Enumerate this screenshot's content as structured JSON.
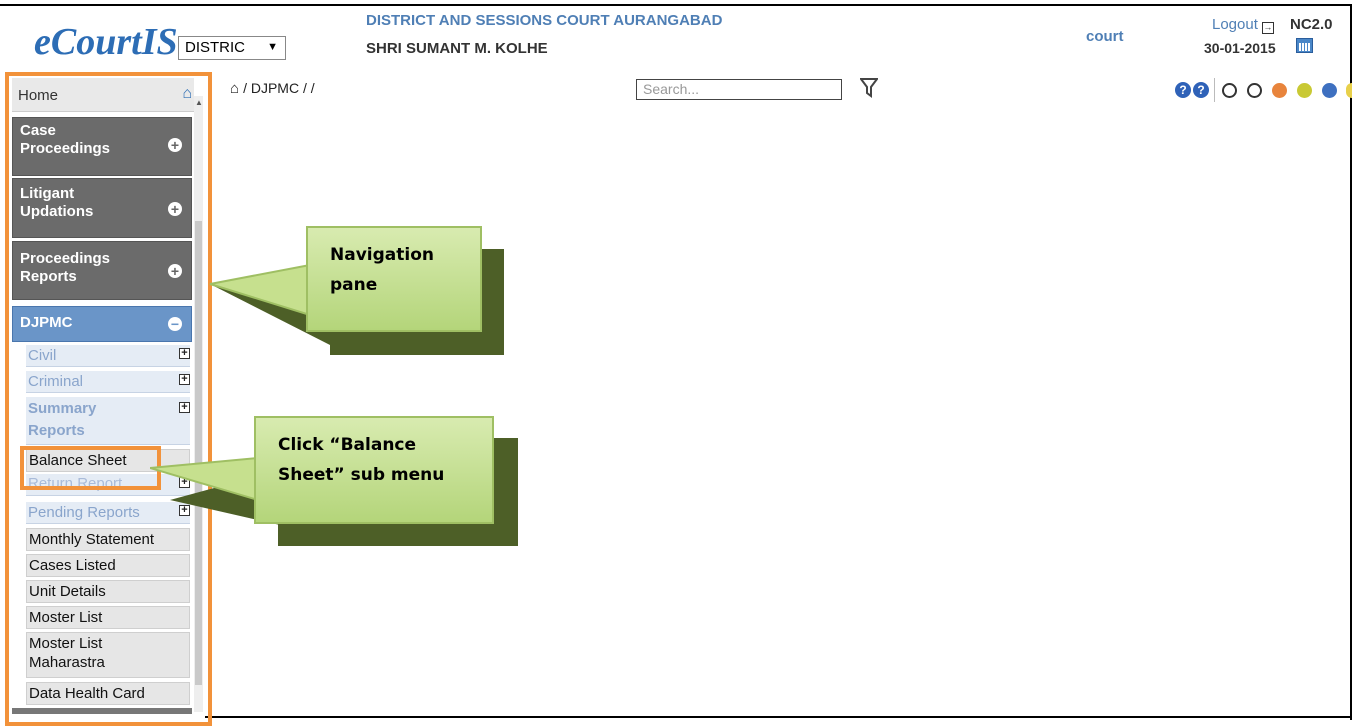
{
  "header": {
    "logo": "eCourtIS",
    "district_select": "DISTRIC",
    "court_name": "DISTRICT AND SESSIONS COURT AURANGABAD",
    "judge_name": "SHRI SUMANT M. KOLHE",
    "user": "court",
    "logout_label": "Logout",
    "version": "NC2.0",
    "date": "30-01-2015"
  },
  "toolbar": {
    "breadcrumb": "/ DJPMC /  /",
    "search_placeholder": "Search...",
    "help_label": "?",
    "status_dots": [
      "#ffffff",
      "#ffffff",
      "#e8843c",
      "#c9c934",
      "#3e70c0",
      "#e8d04a"
    ]
  },
  "sidebar": {
    "home_label": "Home",
    "menus": [
      {
        "line1": "Case",
        "line2": "Proceedings",
        "state": "+"
      },
      {
        "line1": "Litigant",
        "line2": "Updations",
        "state": "+"
      },
      {
        "line1": "Proceedings",
        "line2": "Reports",
        "state": "+"
      },
      {
        "line1": "DJPMC",
        "line2": "",
        "state": "−"
      }
    ],
    "submenus": [
      {
        "label": "Civil"
      },
      {
        "label": "Criminal"
      },
      {
        "line1": "Summary",
        "line2": "Reports"
      },
      {
        "label": "Return Report"
      },
      {
        "label": "Pending Reports"
      }
    ],
    "leaves": [
      {
        "label": "Balance Sheet"
      },
      {
        "label": "Monthly Statement"
      },
      {
        "label": "Cases Listed"
      },
      {
        "label": "Unit Details"
      },
      {
        "label": "Moster List"
      },
      {
        "line1": "Moster List",
        "line2": "Maharastra"
      },
      {
        "label": "Data Health Card"
      }
    ]
  },
  "callouts": {
    "nav": {
      "line1": "Navigation",
      "line2": "pane"
    },
    "balance": {
      "line1": "Click “Balance",
      "line2": "Sheet” sub menu"
    }
  },
  "colors": {
    "highlight": "#f2923a",
    "callout_fill": "#c6e08e",
    "callout_shadow": "#4d5f27",
    "menu_grey": "#6b6b6b",
    "menu_active": "#6a95c8"
  }
}
